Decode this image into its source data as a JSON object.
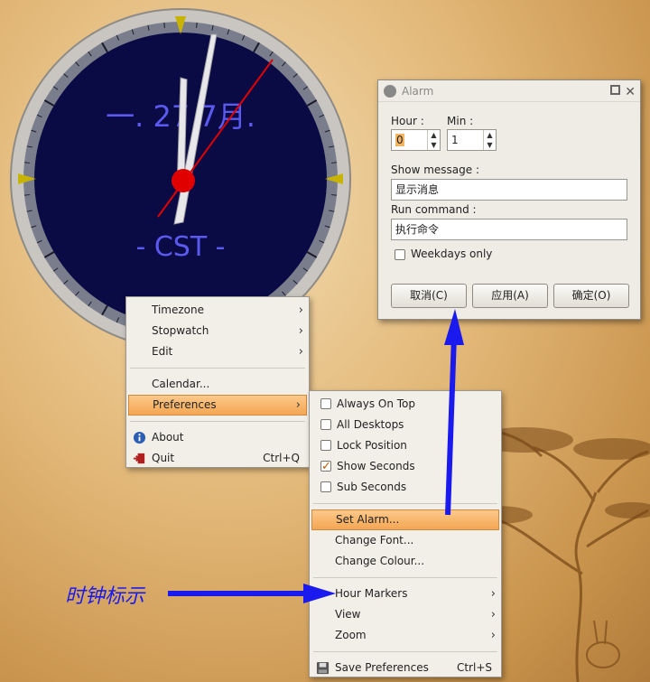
{
  "clock": {
    "date_text": "一. 27 7月.",
    "timezone_text": "- CST -"
  },
  "context_menu": {
    "items": [
      {
        "label": "Timezone",
        "arrow": "›"
      },
      {
        "label": "Stopwatch",
        "arrow": "›"
      },
      {
        "label": "Edit",
        "arrow": "›"
      },
      {
        "label": "Calendar..."
      },
      {
        "label": "Preferences",
        "arrow": "›"
      },
      {
        "label": "About",
        "icon": "info-icon"
      },
      {
        "label": "Quit",
        "shortcut": "Ctrl+Q",
        "icon": "exit-icon"
      }
    ]
  },
  "preferences_menu": {
    "items": [
      {
        "label": "Always On Top",
        "checked": false
      },
      {
        "label": "All Desktops",
        "checked": false
      },
      {
        "label": "Lock Position",
        "checked": false
      },
      {
        "label": "Show Seconds",
        "checked": true
      },
      {
        "label": "Sub Seconds",
        "checked": false
      },
      {
        "label": "Set Alarm..."
      },
      {
        "label": "Change Font..."
      },
      {
        "label": "Change Colour..."
      },
      {
        "label": "Hour Markers",
        "arrow": "›"
      },
      {
        "label": "View",
        "arrow": "›"
      },
      {
        "label": "Zoom",
        "arrow": "›"
      },
      {
        "label": "Save Preferences",
        "shortcut": "Ctrl+S",
        "icon": "save-icon"
      }
    ]
  },
  "alarm_dialog": {
    "title": "Alarm",
    "hour_label": "Hour :",
    "hour_value": "0",
    "min_label": "Min :",
    "min_value": "1",
    "show_message_label": "Show message :",
    "show_message_value": "显示消息",
    "run_command_label": "Run command :",
    "run_command_value": "执行命令",
    "weekdays_label": "Weekdays only",
    "weekdays_checked": false,
    "cancel_label": "取消(C)",
    "apply_label": "应用(A)",
    "ok_label": "确定(O)"
  },
  "annotation": {
    "label": "时钟标示"
  },
  "colors": {
    "clock_face": "#0a0a45",
    "clock_text": "#5a5af0",
    "second_hand": "#e00000",
    "marker": "#c8b400",
    "highlight": "#f4a653",
    "annotation": "#1a1aee"
  }
}
